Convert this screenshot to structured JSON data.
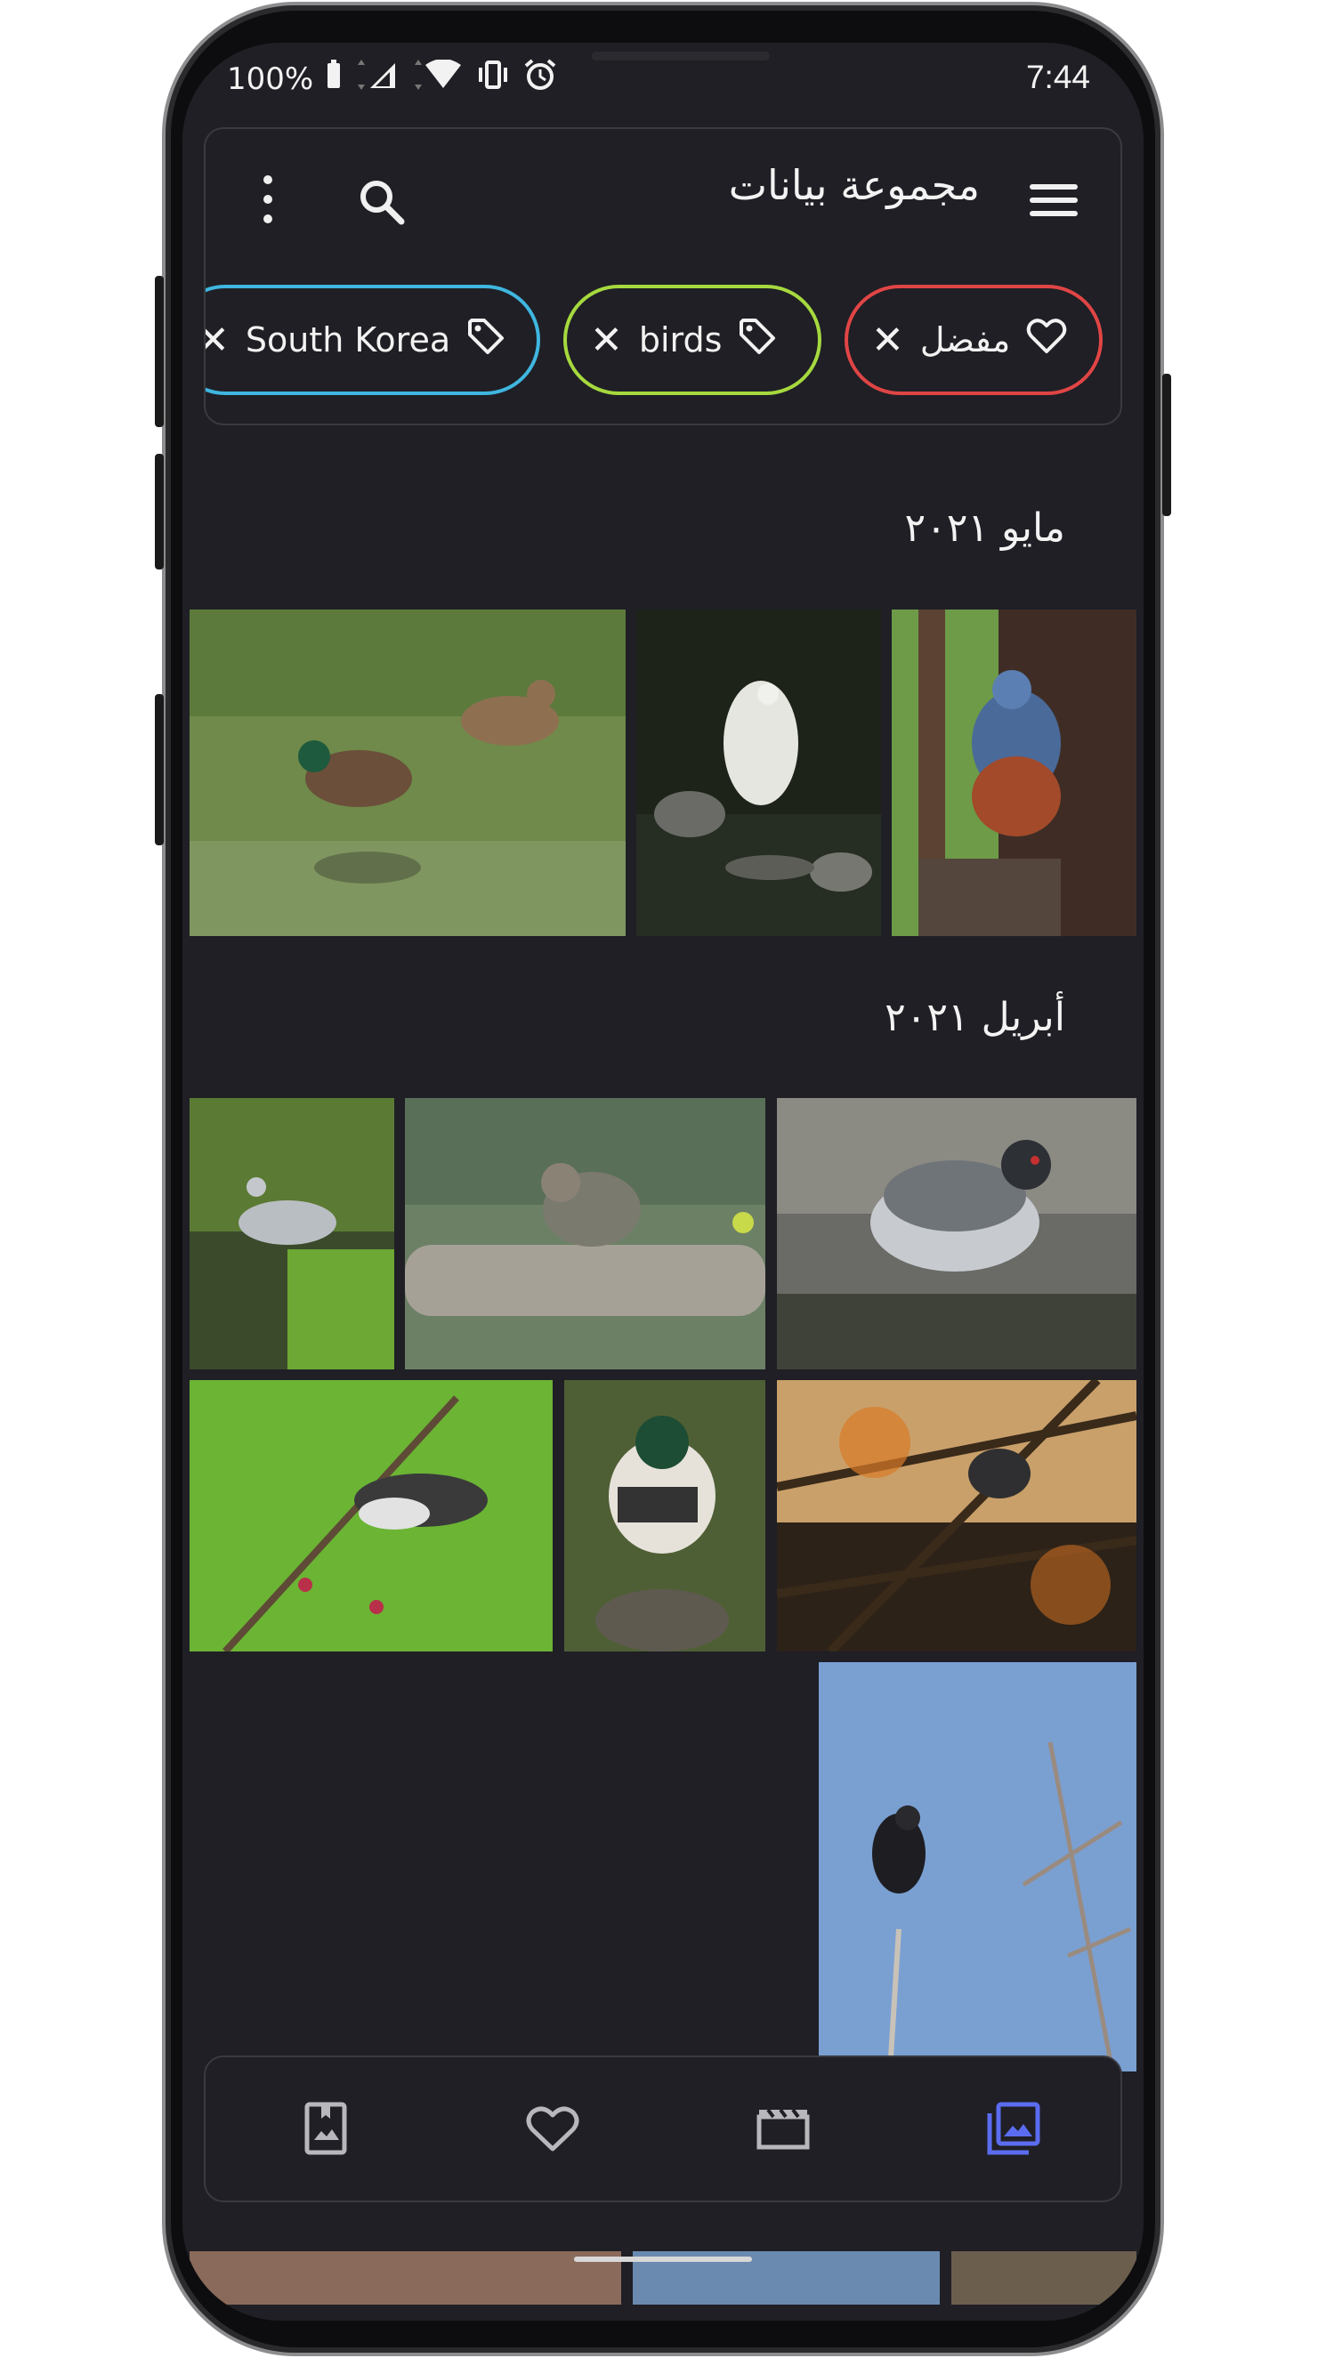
{
  "status_bar": {
    "battery": "100%",
    "time": "7:44"
  },
  "app_bar": {
    "title": "مجموعة بيانات"
  },
  "filters": [
    {
      "label": "مفضل",
      "icon": "heart-icon",
      "color": "#e04545"
    },
    {
      "label": "birds",
      "icon": "tag-icon",
      "color": "#a6d93e"
    },
    {
      "label": "South Korea",
      "icon": "tag-icon",
      "color": "#3fb6e0"
    }
  ],
  "sections": [
    {
      "heading": "مايو ٢٠٢١"
    },
    {
      "heading": "أبريل ٢٠٢١"
    }
  ],
  "bottom_nav": [
    "album-icon",
    "favorites-heart-icon",
    "videos-clapper-icon",
    "collections-icon"
  ],
  "colors": {
    "background": "#1f1f25",
    "accent": "#5b6cf0"
  }
}
